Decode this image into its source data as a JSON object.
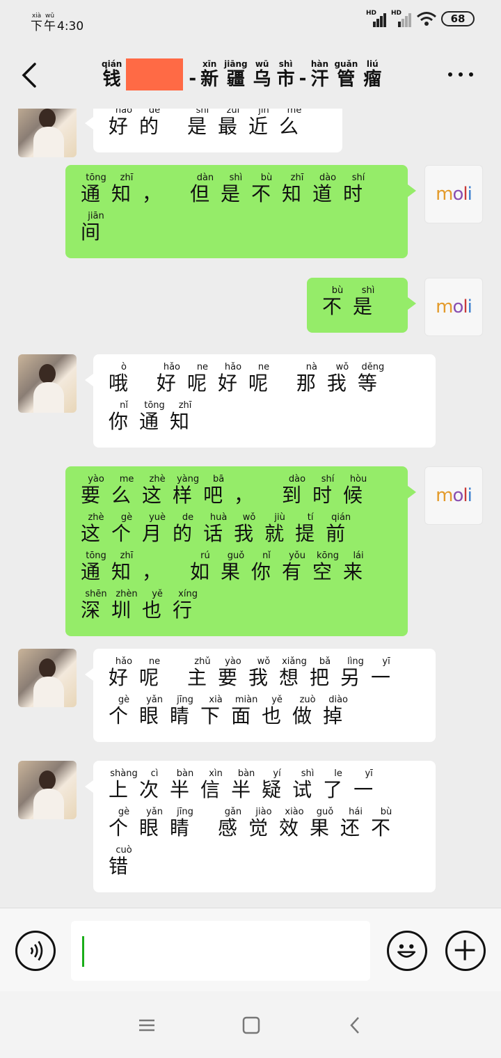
{
  "status_bar": {
    "period": "下午",
    "period_pinyin": [
      "xià",
      "wǔ"
    ],
    "time": "4:30",
    "network_1": "HD",
    "network_2": "HD",
    "battery": "68"
  },
  "header": {
    "title_first": {
      "char": "钱",
      "pinyin": "qián"
    },
    "title_chars": [
      {
        "char": "新",
        "pinyin": "xīn"
      },
      {
        "char": "疆",
        "pinyin": "jiāng"
      },
      {
        "char": "乌",
        "pinyin": "wū"
      },
      {
        "char": "市",
        "pinyin": "shì"
      },
      {
        "char": "汗",
        "pinyin": "hàn"
      },
      {
        "char": "管",
        "pinyin": "guǎn"
      },
      {
        "char": "瘤",
        "pinyin": "liú"
      }
    ],
    "separator": "-",
    "back_icon": "chevron-left-icon",
    "more_icon": "more-dots-icon"
  },
  "messages": [
    {
      "side": "left",
      "lines": [
        [
          [
            "好",
            "hǎo"
          ],
          [
            "的",
            "de"
          ],
          [
            " ",
            ""
          ],
          [
            "是",
            "shì"
          ],
          [
            "最",
            "zuì"
          ],
          [
            "近",
            "jìn"
          ],
          [
            "么",
            "me"
          ]
        ]
      ]
    },
    {
      "side": "right",
      "lines": [
        [
          [
            "通",
            "tōng"
          ],
          [
            "知",
            "zhī"
          ],
          [
            "，",
            ""
          ],
          [
            " ",
            ""
          ],
          [
            "但",
            "dàn"
          ],
          [
            "是",
            "shì"
          ],
          [
            "不",
            "bù"
          ],
          [
            "知",
            "zhī"
          ],
          [
            "道",
            "dào"
          ],
          [
            "时",
            "shí"
          ]
        ],
        [
          [
            "间",
            "jiān"
          ]
        ]
      ]
    },
    {
      "side": "right",
      "lines": [
        [
          [
            "不",
            "bù"
          ],
          [
            "是",
            "shì"
          ]
        ]
      ]
    },
    {
      "side": "left",
      "lines": [
        [
          [
            "哦",
            "ò"
          ],
          [
            " ",
            ""
          ],
          [
            "好",
            "hǎo"
          ],
          [
            "呢",
            "ne"
          ],
          [
            "好",
            "hǎo"
          ],
          [
            "呢",
            "ne"
          ],
          [
            " ",
            ""
          ],
          [
            "那",
            "nà"
          ],
          [
            "我",
            "wǒ"
          ],
          [
            "等",
            "děng"
          ]
        ],
        [
          [
            "你",
            "nǐ"
          ],
          [
            "通",
            "tōng"
          ],
          [
            "知",
            "zhī"
          ]
        ]
      ]
    },
    {
      "side": "right",
      "lines": [
        [
          [
            "要",
            "yào"
          ],
          [
            "么",
            "me"
          ],
          [
            "这",
            "zhè"
          ],
          [
            "样",
            "yàng"
          ],
          [
            "吧",
            "bā"
          ],
          [
            "，",
            ""
          ],
          [
            " ",
            ""
          ],
          [
            "到",
            "dào"
          ],
          [
            "时",
            "shí"
          ],
          [
            "候",
            "hòu"
          ]
        ],
        [
          [
            "这",
            "zhè"
          ],
          [
            "个",
            "gè"
          ],
          [
            "月",
            "yuè"
          ],
          [
            "的",
            "de"
          ],
          [
            "话",
            "huà"
          ],
          [
            "我",
            "wǒ"
          ],
          [
            "就",
            "jiù"
          ],
          [
            "提",
            "tí"
          ],
          [
            "前",
            "qián"
          ]
        ],
        [
          [
            "通",
            "tōng"
          ],
          [
            "知",
            "zhī"
          ],
          [
            "，",
            ""
          ],
          [
            " ",
            ""
          ],
          [
            "如",
            "rú"
          ],
          [
            "果",
            "guǒ"
          ],
          [
            "你",
            "nǐ"
          ],
          [
            "有",
            "yǒu"
          ],
          [
            "空",
            "kōng"
          ],
          [
            "来",
            "lái"
          ]
        ],
        [
          [
            "深",
            "shēn"
          ],
          [
            "圳",
            "zhèn"
          ],
          [
            "也",
            "yě"
          ],
          [
            "行",
            "xíng"
          ]
        ]
      ]
    },
    {
      "side": "left",
      "lines": [
        [
          [
            "好",
            "hǎo"
          ],
          [
            "呢",
            "ne"
          ],
          [
            " ",
            ""
          ],
          [
            "主",
            "zhǔ"
          ],
          [
            "要",
            "yào"
          ],
          [
            "我",
            "wǒ"
          ],
          [
            "想",
            "xiǎng"
          ],
          [
            "把",
            "bǎ"
          ],
          [
            "另",
            "lìng"
          ],
          [
            "一",
            "yī"
          ]
        ],
        [
          [
            "个",
            "gè"
          ],
          [
            "眼",
            "yǎn"
          ],
          [
            "睛",
            "jīng"
          ],
          [
            "下",
            "xià"
          ],
          [
            "面",
            "miàn"
          ],
          [
            "也",
            "yě"
          ],
          [
            "做",
            "zuò"
          ],
          [
            "掉",
            "diào"
          ]
        ]
      ]
    },
    {
      "side": "left",
      "lines": [
        [
          [
            "上",
            "shàng"
          ],
          [
            "次",
            "cì"
          ],
          [
            "半",
            "bàn"
          ],
          [
            "信",
            "xìn"
          ],
          [
            "半",
            "bàn"
          ],
          [
            "疑",
            "yí"
          ],
          [
            "试",
            "shì"
          ],
          [
            "了",
            "le"
          ],
          [
            "一",
            "yī"
          ]
        ],
        [
          [
            "个",
            "gè"
          ],
          [
            "眼",
            "yǎn"
          ],
          [
            "睛",
            "jīng"
          ],
          [
            " ",
            ""
          ],
          [
            "感",
            "gǎn"
          ],
          [
            "觉",
            "jiào"
          ],
          [
            "效",
            "xiào"
          ],
          [
            "果",
            "guǒ"
          ],
          [
            "还",
            "hái"
          ],
          [
            "不",
            "bù"
          ]
        ],
        [
          [
            "错",
            "cuò"
          ]
        ]
      ]
    }
  ],
  "self_avatar_text": "moli",
  "input_bar": {
    "voice_icon": "voice-icon",
    "emoji_icon": "emoji-icon",
    "plus_icon": "plus-icon",
    "input_value": ""
  },
  "nav_bar": {
    "menu_icon": "menu-icon",
    "home_icon": "home-icon",
    "back_icon": "back-icon"
  }
}
